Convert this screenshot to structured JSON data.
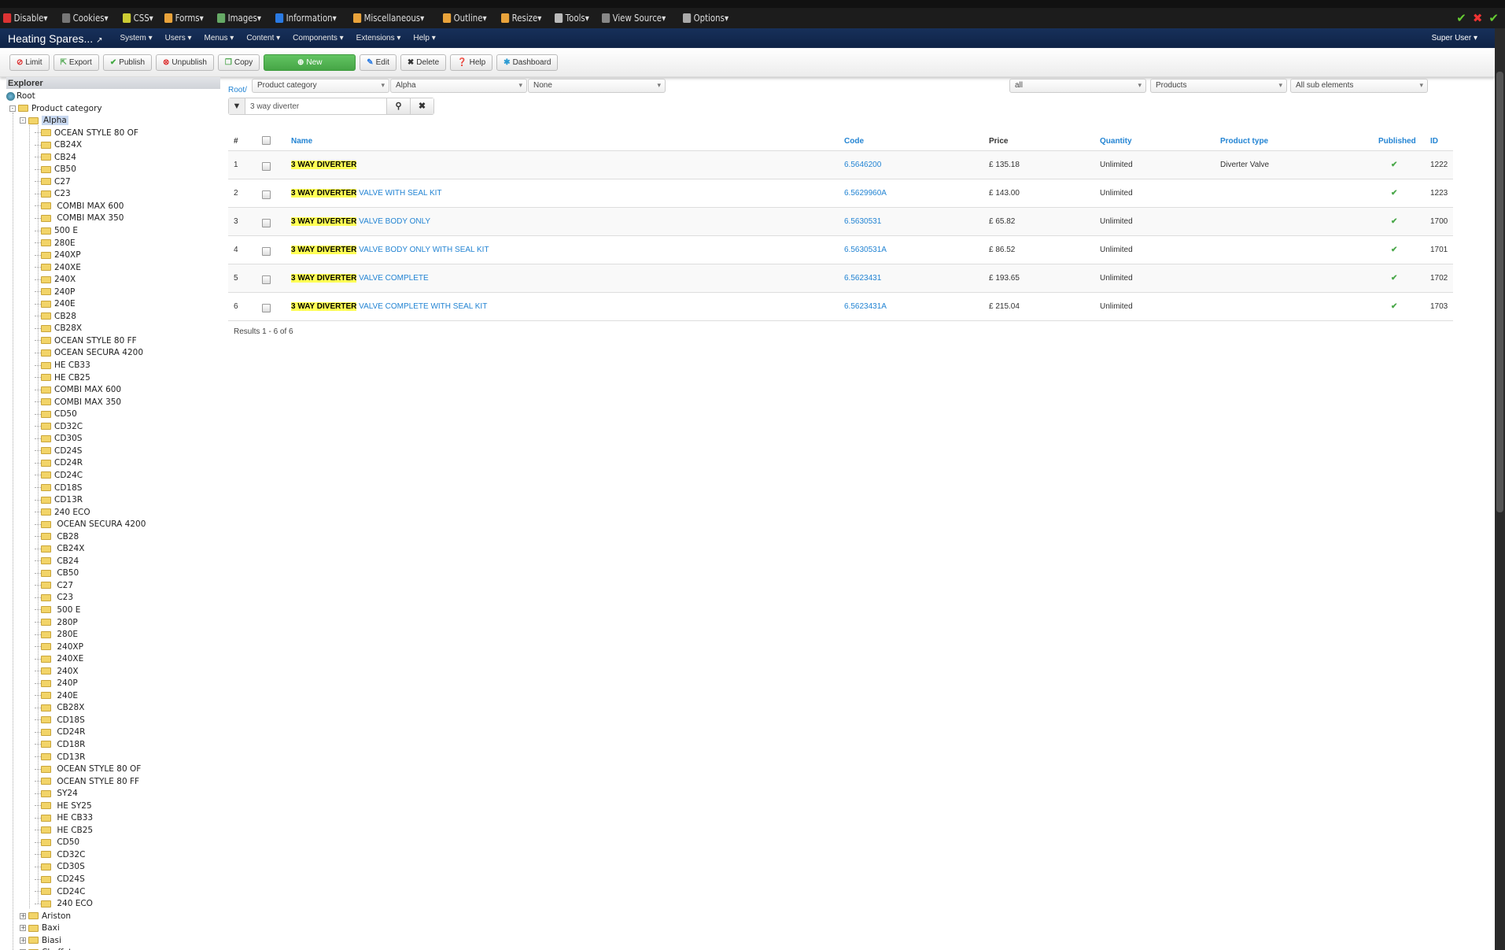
{
  "devbar": {
    "items": [
      {
        "label": "Disable▾",
        "color": "#d33"
      },
      {
        "label": "Cookies▾",
        "color": "#777"
      },
      {
        "label": "CSS▾",
        "color": "#cc3"
      },
      {
        "label": "Forms▾",
        "color": "#e9a33b"
      },
      {
        "label": "Images▾",
        "color": "#6a6"
      },
      {
        "label": "Information▾",
        "color": "#2a7ae2"
      },
      {
        "label": "Miscellaneous▾",
        "color": "#e9a33b"
      },
      {
        "label": "Outline▾",
        "color": "#e9a33b"
      },
      {
        "label": "Resize▾",
        "color": "#e9a33b"
      },
      {
        "label": "Tools▾",
        "color": "#bbb"
      },
      {
        "label": "View Source▾",
        "color": "#888"
      },
      {
        "label": "Options▾",
        "color": "#aaa"
      }
    ]
  },
  "nav": {
    "brand": "Heating Spares...",
    "menus": [
      "System ▾",
      "Users ▾",
      "Menus ▾",
      "Content ▾",
      "Components ▾",
      "Extensions ▾",
      "Help ▾"
    ],
    "user": "Super User ▾"
  },
  "toolbar": {
    "limit": "Limit",
    "export": "Export",
    "publish": "Publish",
    "unpublish": "Unpublish",
    "copy": "Copy",
    "new": "New",
    "edit": "Edit",
    "delete": "Delete",
    "help": "Help",
    "dashboard": "Dashboard"
  },
  "sidebar": {
    "title": "Explorer",
    "root": "Root",
    "category": "Product category",
    "alpha": "Alpha",
    "alpha_children": [
      "OCEAN STYLE 80 OF",
      "CB24X",
      "CB24",
      "CB50",
      "C27",
      "C23",
      " COMBI MAX 600",
      " COMBI MAX 350",
      "500 E",
      "280E",
      "240XP",
      "240XE",
      "240X",
      "240P",
      "240E",
      "CB28",
      "CB28X",
      "OCEAN STYLE 80 FF",
      "OCEAN SECURA 4200",
      "HE CB33",
      "HE CB25",
      "COMBI MAX 600",
      "COMBI MAX 350",
      "CD50",
      "CD32C",
      "CD30S",
      "CD24S",
      "CD24R",
      "CD24C",
      "CD18S",
      "CD13R",
      "240 ECO",
      " OCEAN SECURA 4200",
      " CB28",
      " CB24X",
      " CB24",
      " CB50",
      " C27",
      " C23",
      " 500 E",
      " 280P",
      " 280E",
      " 240XP",
      " 240XE",
      " 240X",
      " 240P",
      " 240E",
      " CB28X",
      " CD18S",
      " CD24R",
      " CD18R",
      " CD13R",
      " OCEAN STYLE 80 OF",
      " OCEAN STYLE 80 FF",
      " SY24",
      " HE SY25",
      " HE CB33",
      " HE CB25",
      " CD50",
      " CD32C",
      " CD30S",
      " CD24S",
      " CD24C",
      " 240 ECO"
    ],
    "brands": [
      "Ariston",
      "Baxi",
      "Biasi",
      "Chaffoteaux"
    ]
  },
  "filters": {
    "root": "Root/",
    "category": "Product category",
    "alpha": "Alpha",
    "none": "None",
    "all": "all",
    "products": "Products",
    "sub": "All sub elements",
    "search_value": "3 way diverter"
  },
  "table": {
    "headers": {
      "num": "#",
      "name": "Name",
      "code": "Code",
      "price": "Price",
      "quantity": "Quantity",
      "type": "Product type",
      "published": "Published",
      "id": "ID"
    },
    "highlight": "3 WAY DIVERTER",
    "rows": [
      {
        "n": "1",
        "rest": "",
        "code": "6.5646200",
        "price": "£ 135.18",
        "qty": "Unlimited",
        "type": "Diverter Valve",
        "id": "1222"
      },
      {
        "n": "2",
        "rest": " VALVE WITH SEAL KIT",
        "code": "6.5629960A",
        "price": "£ 143.00",
        "qty": "Unlimited",
        "type": "",
        "id": "1223"
      },
      {
        "n": "3",
        "rest": " VALVE BODY ONLY",
        "code": "6.5630531",
        "price": "£ 65.82",
        "qty": "Unlimited",
        "type": "",
        "id": "1700"
      },
      {
        "n": "4",
        "rest": " VALVE BODY ONLY WITH SEAL KIT",
        "code": "6.5630531A",
        "price": "£ 86.52",
        "qty": "Unlimited",
        "type": "",
        "id": "1701"
      },
      {
        "n": "5",
        "rest": " VALVE COMPLETE",
        "code": "6.5623431",
        "price": "£ 193.65",
        "qty": "Unlimited",
        "type": "",
        "id": "1702"
      },
      {
        "n": "6",
        "rest": " VALVE COMPLETE WITH SEAL KIT",
        "code": "6.5623431A",
        "price": "£ 215.04",
        "qty": "Unlimited",
        "type": "",
        "id": "1703"
      }
    ]
  },
  "results": "Results 1 - 6 of 6"
}
